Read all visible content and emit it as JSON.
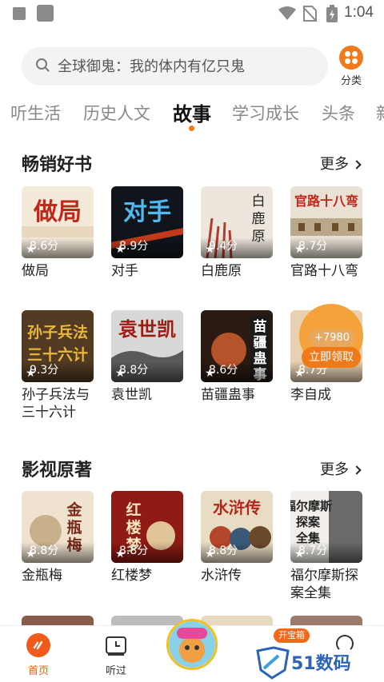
{
  "status_bar": {
    "time": "1:04"
  },
  "search": {
    "placeholder_text": "全球御鬼：我的体内有亿只鬼",
    "category_label": "分类"
  },
  "tabs": [
    {
      "label": "听生活"
    },
    {
      "label": "历史人文"
    },
    {
      "label": "故事",
      "active": true
    },
    {
      "label": "学习成长"
    },
    {
      "label": "头条"
    },
    {
      "label": "新"
    }
  ],
  "sections": [
    {
      "title": "畅销好书",
      "more_label": "更多",
      "books": [
        {
          "title": "做局",
          "rating": "8.6分",
          "cover_text": "做局"
        },
        {
          "title": "对手",
          "rating": "8.9分",
          "cover_text": "对手"
        },
        {
          "title": "白鹿原",
          "rating": "9.4分",
          "cover_text": "白鹿原"
        },
        {
          "title": "官路十八弯",
          "rating": "8.7分",
          "cover_text": "官路十八弯"
        },
        {
          "title": "孙子兵法与三十六计",
          "rating": "9.3分",
          "cover_text": "孙子兵法与三十六计"
        },
        {
          "title": "袁世凯",
          "rating": "8.8分",
          "cover_text": "袁世凯"
        },
        {
          "title": "苗疆蛊事",
          "rating": "8.6分",
          "cover_text": "苗疆蛊事"
        },
        {
          "title": "李自成",
          "rating": "8.7分",
          "cover_text": ""
        }
      ]
    },
    {
      "title": "影视原著",
      "more_label": "更多",
      "books": [
        {
          "title": "金瓶梅",
          "rating": "8.8分",
          "cover_text": "金瓶梅"
        },
        {
          "title": "红楼梦",
          "rating": "8.8分",
          "cover_text": "红楼梦"
        },
        {
          "title": "水浒传",
          "rating": "8.8分",
          "cover_text": "水浒传"
        },
        {
          "title": "福尔摩斯探案全集",
          "rating": "8.7分",
          "cover_text": "福尔摩斯探案全集"
        }
      ]
    }
  ],
  "reward": {
    "amount": "+7980",
    "button": "立即领取"
  },
  "bottom_nav": {
    "home": "首页",
    "heard": "听过",
    "treasure_badge": "开宝箱"
  },
  "watermark": {
    "text": "51数码"
  },
  "colors": {
    "accent": "#f07a1a",
    "rating_star": "#ffffff"
  }
}
